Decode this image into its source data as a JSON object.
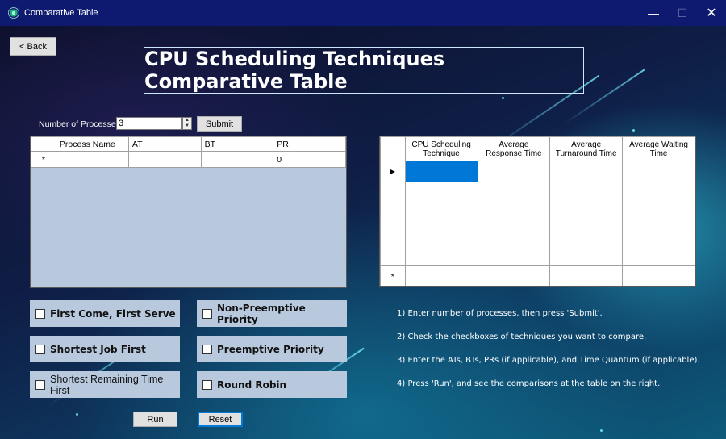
{
  "window": {
    "title": "Comparative Table",
    "minimize": "—",
    "maximize": "☐",
    "close": "✕"
  },
  "back_button": "< Back",
  "banner_title": "CPU Scheduling Techniques Comparative Table",
  "processes": {
    "label": "Number of Processes:",
    "value": "3",
    "submit": "Submit"
  },
  "process_grid": {
    "columns": [
      "Process Name",
      "AT",
      "BT",
      "PR"
    ],
    "new_row_marker": "*",
    "new_row": [
      "",
      "",
      "",
      "0"
    ]
  },
  "results_grid": {
    "columns": [
      [
        "CPU Scheduling",
        "Technique"
      ],
      [
        "Average",
        "Response Time"
      ],
      [
        "Average",
        "Turnaround Time"
      ],
      [
        "Average Waiting",
        "Time"
      ]
    ],
    "current_row_marker": "▶",
    "new_row_marker": "*"
  },
  "techniques": [
    {
      "label": "First Come, First Serve",
      "checked": false
    },
    {
      "label": "Non-Preemptive Priority",
      "checked": false
    },
    {
      "label": "Shortest Job First",
      "checked": false
    },
    {
      "label": "Preemptive Priority",
      "checked": false
    },
    {
      "label": "Shortest Remaining Time First",
      "checked": false
    },
    {
      "label": "Round Robin",
      "checked": false
    }
  ],
  "run_button": "Run",
  "reset_button": "Reset",
  "instructions": [
    "1)  Enter number of processes, then press 'Submit'.",
    "2)  Check the checkboxes of techniques you want to compare.",
    "3)  Enter the ATs, BTs, PRs (if applicable), and Time Quantum (if applicable).",
    "4)  Press 'Run', and see the comparisons at the table on the right."
  ]
}
